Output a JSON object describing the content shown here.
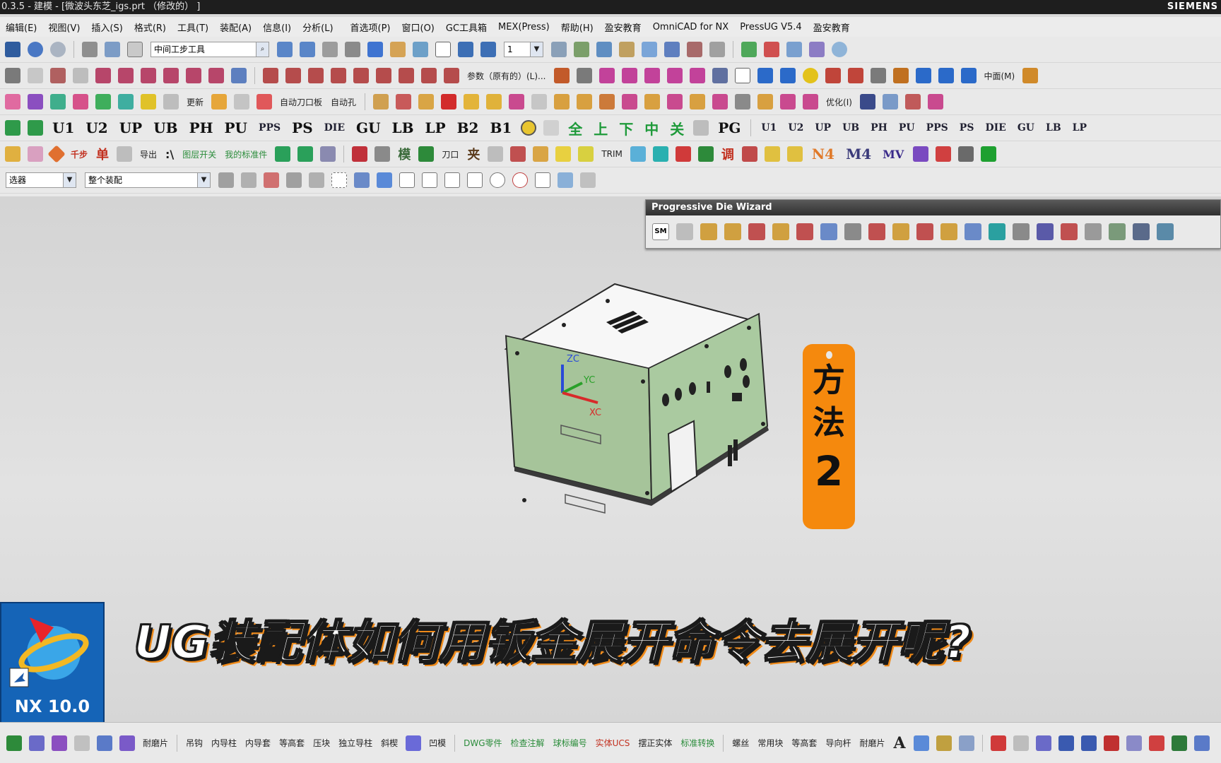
{
  "title": "0.3.5 - 建模 - [微波头东芝_igs.prt （修改的） ]",
  "brand": "SIEMENS",
  "menu": [
    "编辑(E)",
    "视图(V)",
    "插入(S)",
    "格式(R)",
    "工具(T)",
    "装配(A)",
    "信息(I)",
    "分析(L)",
    "首选项(P)",
    "窗口(O)",
    "GC工具箱",
    "MEX(Press)",
    "帮助(H)",
    "盈安教育",
    "OmniCAD for NX",
    "PressUG V5.4",
    "盈安教育"
  ],
  "toolbar": {
    "step_tool": "中间工步工具",
    "layer_value": "1",
    "row2_texts": [
      "参数（原有的）(L)...",
      "中面(M)"
    ],
    "row3_texts": [
      "更新",
      "自动刀口板",
      "自动孔",
      "优化(I)"
    ],
    "row4_codes": [
      "U1",
      "U2",
      "UP",
      "UB",
      "PH",
      "PU",
      "PPS",
      "PS",
      "DIE",
      "GU",
      "LB",
      "LP",
      "B2",
      "B1"
    ],
    "row4_big": [
      "全",
      "上",
      "下",
      "中",
      "关"
    ],
    "row4_more": [
      "PG"
    ],
    "row4_small": [
      "U1",
      "U2",
      "UP",
      "UB",
      "PH",
      "PU",
      "PPS",
      "PS",
      "DIE",
      "GU",
      "LB",
      "LP"
    ],
    "row5_texts": [
      "千步",
      "单",
      "导出",
      "图层开关",
      "我的标准件",
      "模",
      "刀口",
      "夹",
      "TRIM",
      "调",
      "N4",
      "M4",
      "MV"
    ],
    "filter1": "选器",
    "filter2": "整个装配"
  },
  "wizard": {
    "title": "Progressive Die Wizard",
    "sm": "SM"
  },
  "cube": {
    "axes": [
      "ZC",
      "YC",
      "XC"
    ]
  },
  "tag": {
    "line1": "方",
    "line2": "法",
    "line3": "2"
  },
  "caption": "UG装配体如何用钣金展开命令去展开呢?",
  "nx_icon": {
    "label": "NX 10.0"
  },
  "bottom": {
    "texts": [
      "耐磨片",
      "吊钩",
      "内导柱",
      "内导套",
      "等高套",
      "压块",
      "独立导柱",
      "斜楔",
      "凹模",
      "DWG零件",
      "检查注解",
      "球标编号",
      "实体UCS",
      "摆正实体",
      "标准转换",
      "螺丝",
      "常用块",
      "等高套",
      "导向杆",
      "耐磨片",
      "A"
    ]
  },
  "colors": {
    "accent": "#f5890d",
    "panel_green": "#a6c49a",
    "wizard_bar": "#3a3a3a",
    "nx_blue": "#1564b7"
  }
}
